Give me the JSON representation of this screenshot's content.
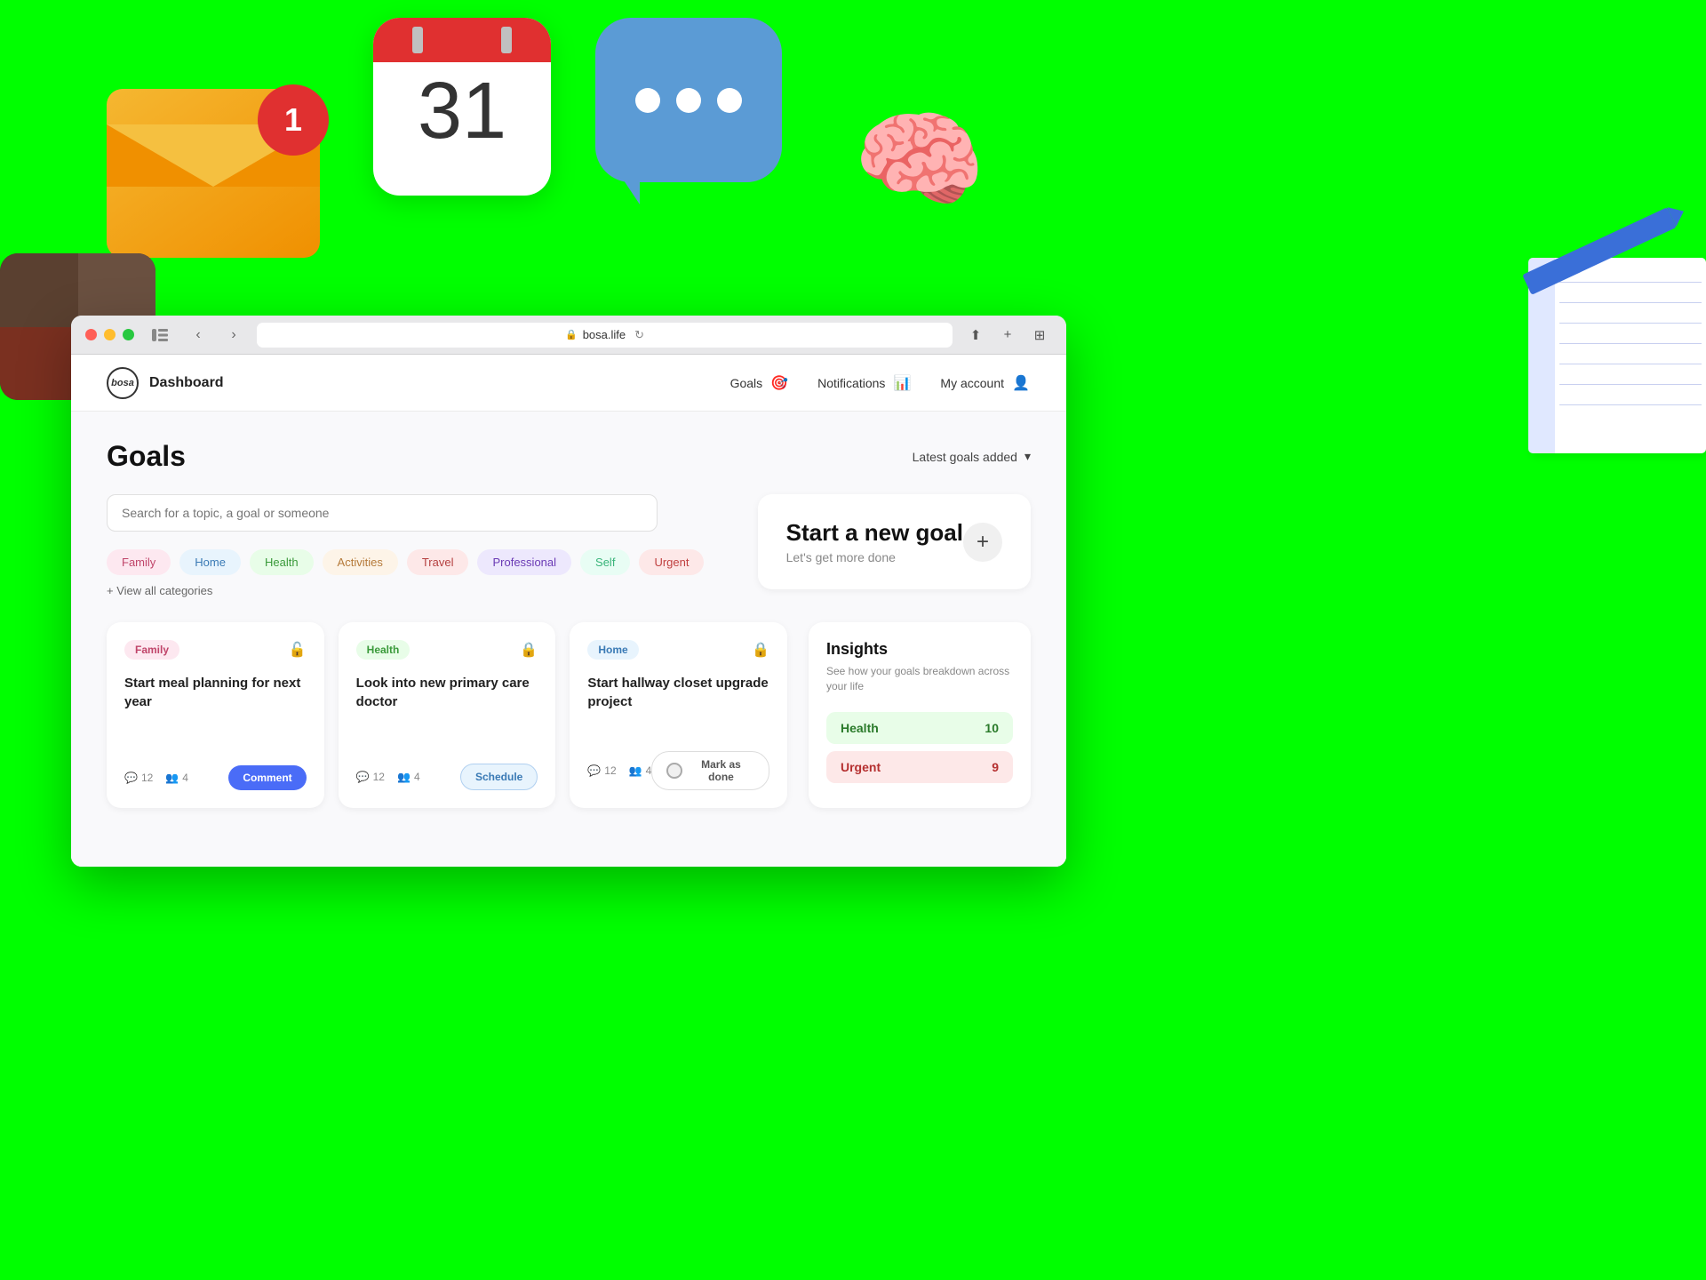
{
  "background": {
    "color": "#00ff00"
  },
  "browser": {
    "url": "bosa.life",
    "back_btn": "‹",
    "forward_btn": "›"
  },
  "app": {
    "logo_text": "bosa",
    "title": "Dashboard",
    "nav": {
      "goals_label": "Goals",
      "notifications_label": "Notifications",
      "my_account_label": "My account"
    }
  },
  "page": {
    "title": "Goals",
    "sort_label": "Latest goals added",
    "search_placeholder": "Search for a topic, a goal or someone"
  },
  "categories": [
    {
      "id": "family",
      "label": "Family",
      "class": "pill-family"
    },
    {
      "id": "home",
      "label": "Home",
      "class": "pill-home"
    },
    {
      "id": "health",
      "label": "Health",
      "class": "pill-health"
    },
    {
      "id": "activities",
      "label": "Activities",
      "class": "pill-activities"
    },
    {
      "id": "travel",
      "label": "Travel",
      "class": "pill-travel"
    },
    {
      "id": "professional",
      "label": "Professional",
      "class": "pill-professional"
    },
    {
      "id": "self",
      "label": "Self",
      "class": "pill-self"
    },
    {
      "id": "urgent",
      "label": "Urgent",
      "class": "pill-urgent"
    }
  ],
  "view_all_label": "+ View all categories",
  "new_goal": {
    "title": "Start a new goal",
    "subtitle": "Let's get more done",
    "plus_icon": "+"
  },
  "goal_cards": [
    {
      "tag": "Family",
      "tag_class": "goal-tag-family",
      "title": "Start meal planning for next year",
      "comments": "12",
      "people": "4",
      "action_label": "Comment",
      "action_class": "btn-comment"
    },
    {
      "tag": "Health",
      "tag_class": "goal-tag-health",
      "title": "Look into new primary care doctor",
      "comments": "12",
      "people": "4",
      "action_label": "Schedule",
      "action_class": "btn-schedule"
    },
    {
      "tag": "Home",
      "tag_class": "goal-tag-home",
      "title": "Start hallway closet upgrade project",
      "comments": "12",
      "people": "4",
      "action_label": "Mark as done",
      "action_class": "btn-mark-done"
    }
  ],
  "insights": {
    "title": "Insights",
    "subtitle": "See how your goals breakdown across your life",
    "bars": [
      {
        "label": "Health",
        "value": "10",
        "class": "insight-bar-health"
      },
      {
        "label": "Urgent",
        "value": "9",
        "class": "insight-bar-urgent"
      }
    ]
  }
}
